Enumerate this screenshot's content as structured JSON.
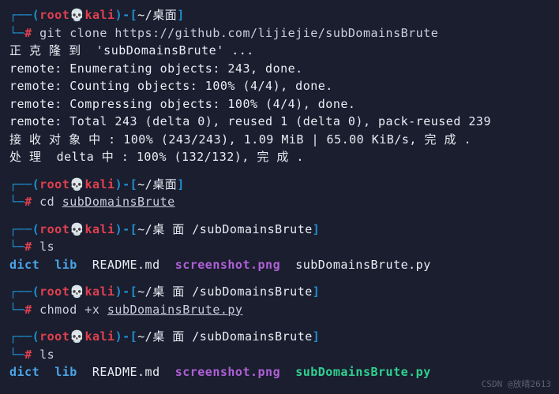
{
  "prompts": [
    {
      "user": "root",
      "host": "kali",
      "path": "~/桌面",
      "symbol_open": "┌──(",
      "skull": "💀",
      "symbol_close": ")-[",
      "bracket_close": "]",
      "line2_prefix": "└─",
      "hash": "# ",
      "command": "git clone https://github.com/lijiejie/subDomainsBrute",
      "underlined": ""
    },
    {
      "user": "root",
      "host": "kali",
      "path": "~/桌面",
      "command_prefix": "cd ",
      "underlined": "subDomainsBrute"
    },
    {
      "user": "root",
      "host": "kali",
      "path": "~/桌 面 /subDomainsBrute",
      "command_prefix": "ls",
      "underlined": ""
    },
    {
      "user": "root",
      "host": "kali",
      "path": "~/桌 面 /subDomainsBrute",
      "command_prefix": "chmod +x ",
      "underlined": "subDomainsBrute.py"
    },
    {
      "user": "root",
      "host": "kali",
      "path": "~/桌 面 /subDomainsBrute",
      "command_prefix": "ls",
      "underlined": ""
    }
  ],
  "output": {
    "clone_lines": [
      "正 克 隆 到  'subDomainsBrute' ...",
      "remote: Enumerating objects: 243, done.",
      "remote: Counting objects: 100% (4/4), done.",
      "remote: Compressing objects: 100% (4/4), done.",
      "remote: Total 243 (delta 0), reused 1 (delta 0), pack-reused 239",
      "接 收 对 象 中 : 100% (243/243), 1.09 MiB | 65.00 KiB/s, 完 成 .",
      "处 理  delta 中 : 100% (132/132), 完 成 ."
    ],
    "ls1": {
      "dict": "dict",
      "lib": "lib",
      "readme": "README.md",
      "screenshot": "screenshot.png",
      "script": "subDomainsBrute.py"
    },
    "ls2": {
      "dict": "dict",
      "lib": "lib",
      "readme": "README.md",
      "screenshot": "screenshot.png",
      "script": "subDomainsBrute.py"
    }
  },
  "watermark": "CSDN @放晴2613",
  "glyphs": {
    "box_tl": "┌──(",
    "box_bl": "└─",
    "hash": "# ",
    "skull": "💀",
    "close_paren": ")-[",
    "close_bracket": "]"
  }
}
